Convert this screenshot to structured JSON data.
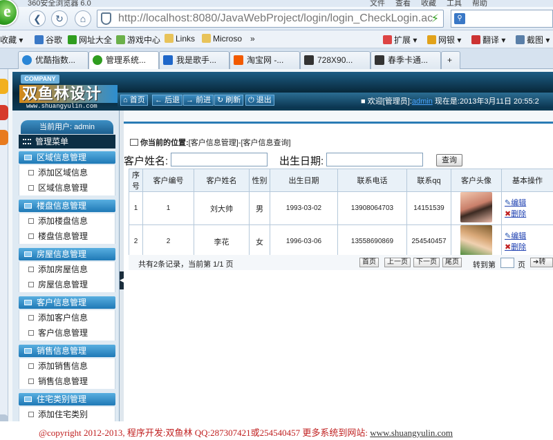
{
  "browser": {
    "title": "360安全浏览器 6.0",
    "title_menu": [
      "文件",
      "查看",
      "收藏",
      "工具",
      "帮助"
    ],
    "address": "http://localhost:8080/JavaWebProject/login/login_CheckLogin.ac",
    "address_host": "localhost",
    "favorites": [
      "收藏",
      "谷歌",
      "网址大全",
      "游戏中心",
      "Links",
      "Microso",
      "»"
    ],
    "right_tools": [
      "扩展",
      "网银",
      "翻译",
      "截图"
    ],
    "tabs": [
      "优酷指数...",
      "管理系统...",
      "我是歌手...",
      "淘宝网 -...",
      "728X90...",
      "春季卡通..."
    ]
  },
  "header": {
    "company": "COMPANY",
    "logo": "双鱼林设计",
    "logo_sub": "www.shuangyulin.com",
    "nav": [
      "首页",
      "后退",
      "前进",
      "刷新",
      "退出"
    ],
    "welcome_prefix": "欢迎[管理员]:",
    "welcome_user": "admin",
    "now_label": "现在是:",
    "now_value": "2013年3月11日 20:55:2"
  },
  "sidebar": {
    "current_user": "当前用户: admin",
    "menu_title": "管理菜单",
    "sections": [
      {
        "title": "区域信息管理",
        "items": [
          "添加区域信息",
          "区域信息管理"
        ]
      },
      {
        "title": "楼盘信息管理",
        "items": [
          "添加楼盘信息",
          "楼盘信息管理"
        ]
      },
      {
        "title": "房屋信息管理",
        "items": [
          "添加房屋信息",
          "房屋信息管理"
        ]
      },
      {
        "title": "客户信息管理",
        "items": [
          "添加客户信息",
          "客户信息管理"
        ]
      },
      {
        "title": "销售信息管理",
        "items": [
          "添加销售信息",
          "销售信息管理"
        ]
      },
      {
        "title": "住宅类别管理",
        "items": [
          "添加住宅类别"
        ]
      }
    ]
  },
  "content": {
    "location_label": "你当前的位置:",
    "location_path": "[客户信息管理]-[客户信息查询]",
    "search": {
      "name_label": "客户姓名:",
      "name_value": "",
      "birth_label": "出生日期:",
      "birth_value": "",
      "query_button": "查询"
    },
    "table": {
      "headers": [
        "序号",
        "客户编号",
        "客户姓名",
        "性别",
        "出生日期",
        "联系电话",
        "联系qq",
        "客户头像",
        "基本操作"
      ],
      "rows": [
        {
          "index": "1",
          "code": "1",
          "name": "刘大帅",
          "gender": "男",
          "birth": "1993-03-02",
          "phone": "13908064703",
          "qq": "14151539",
          "edit": "编辑",
          "delete": "删除"
        },
        {
          "index": "2",
          "code": "2",
          "name": "李花",
          "gender": "女",
          "birth": "1996-03-06",
          "phone": "13558690869",
          "qq": "254540457",
          "edit": "编辑",
          "delete": "删除"
        }
      ]
    },
    "pager": {
      "summary": "共有2条记录，当前第 1/1 页",
      "first": "首页",
      "prev": "上一页",
      "next": "下一页",
      "last": "尾页",
      "goto_label": "转到第",
      "page_unit": "页",
      "goto_button": "转"
    }
  },
  "footer": {
    "text": "@copyright 2012-2013, 程序开发:双鱼林  QQ:287307421或254540457  更多系统到网站: ",
    "link": "www.shuangyulin.com"
  }
}
